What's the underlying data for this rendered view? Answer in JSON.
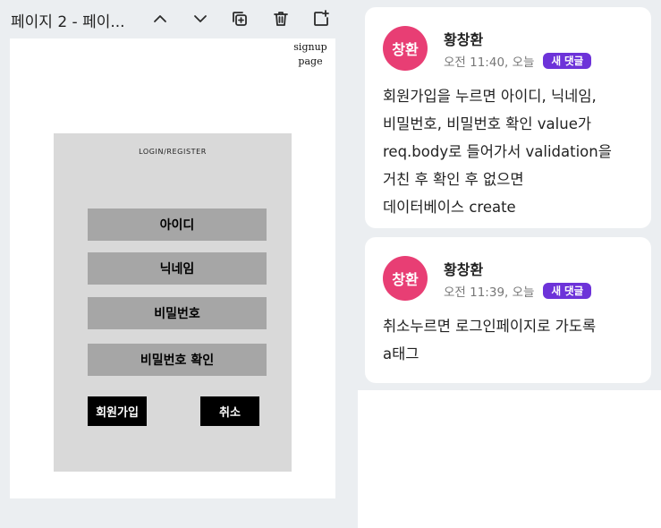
{
  "left_panel": {
    "toolbar": {
      "page_title": "페이지 2 - 페이...",
      "icons": [
        "chevron-up-icon",
        "chevron-down-icon",
        "duplicate-icon",
        "trash-icon",
        "add-page-icon"
      ]
    },
    "canvas": {
      "signup_label_line1": "signup",
      "signup_label_line2": "page",
      "form": {
        "title": "LOGIN/REGISTER",
        "fields": [
          "아이디",
          "닉네임",
          "비밀번호",
          "비밀번호 확인"
        ],
        "signup_button": "회원가입",
        "cancel_button": "취소"
      }
    }
  },
  "comments": [
    {
      "avatar_text": "창환",
      "author": "황창환",
      "time": "오전 11:40, 오늘",
      "badge": "새 댓글",
      "lines": [
        "회원가입을 누르면 아이디, 닉네임,",
        "비밀번호, 비밀번호 확인 value가",
        "req.body로 들어가서 validation을",
        "거친 후 확인 후 없으면",
        "데이터베이스 create"
      ]
    },
    {
      "avatar_text": "창환",
      "author": "황창환",
      "time": "오전 11:39, 오늘",
      "badge": "새 댓글",
      "lines": [
        "취소누르면 로그인페이지로 가도록",
        "a태그"
      ]
    }
  ],
  "colors": {
    "panel_bg": "#ebeef1",
    "avatar": "#e83e74",
    "badge": "#6d33d9",
    "form_bg": "#d9d9d9",
    "field_bg": "#a6a6a6"
  }
}
